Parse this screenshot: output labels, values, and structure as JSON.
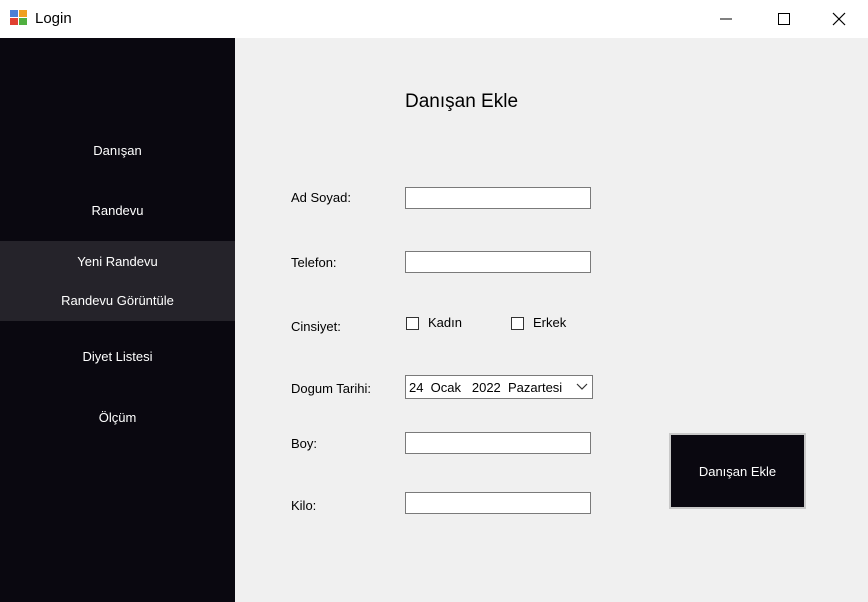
{
  "window": {
    "title": "Login"
  },
  "sidebar": {
    "items": [
      {
        "label": "Danışan"
      },
      {
        "label": "Randevu"
      },
      {
        "label": "Yeni Randevu"
      },
      {
        "label": "Randevu Görüntüle"
      },
      {
        "label": "Diyet Listesi"
      },
      {
        "label": "Ölçüm"
      }
    ]
  },
  "form": {
    "heading": "Danışan Ekle",
    "name_label": "Ad Soyad:",
    "name_value": "",
    "phone_label": "Telefon:",
    "phone_value": "",
    "gender_label": "Cinsiyet:",
    "female_label": "Kadın",
    "male_label": "Erkek",
    "birthdate_label": "Dogum Tarihi:",
    "birthdate_value": "24  Ocak   2022  Pazartesi",
    "height_label": "Boy:",
    "height_value": "",
    "weight_label": "Kilo:",
    "weight_value": "",
    "submit_label": "Danışan Ekle"
  },
  "colors": {
    "sidebar_bg": "#0a0810",
    "submenu_bg": "#25232a",
    "content_bg": "#f0f0f0"
  }
}
